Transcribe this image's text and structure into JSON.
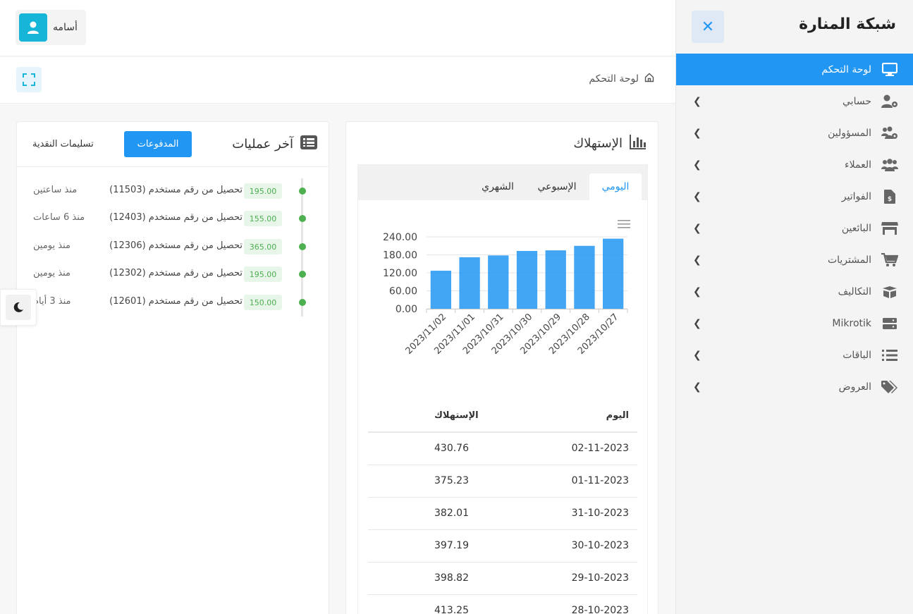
{
  "sidebar": {
    "brand": "شبكة المنارة",
    "items": [
      {
        "label": "لوحة التحكم",
        "icon": "monitor-icon",
        "active": true
      },
      {
        "label": "حسابي",
        "icon": "user-cog-icon"
      },
      {
        "label": "المسؤولين",
        "icon": "users-cog-icon"
      },
      {
        "label": "العملاء",
        "icon": "users-icon"
      },
      {
        "label": "الفواتير",
        "icon": "invoice-dollar-icon"
      },
      {
        "label": "البائعين",
        "icon": "store-icon"
      },
      {
        "label": "المشتريات",
        "icon": "cart-icon"
      },
      {
        "label": "التكاليف",
        "icon": "box-open-icon"
      },
      {
        "label": "Mikrotik",
        "icon": "server-icon"
      },
      {
        "label": "الباقات",
        "icon": "list-icon"
      },
      {
        "label": "العروض",
        "icon": "tags-icon"
      }
    ]
  },
  "topbar": {
    "user_name": "أسامه"
  },
  "breadcrumb": {
    "current": "لوحة التحكم"
  },
  "operations": {
    "title": "آخر عمليات",
    "tab_payments": "المدفوعات",
    "tab_cash": "تسليمات النقدية",
    "items": [
      {
        "amount": "195.00",
        "text": "تحصيل من رقم مستخدم (11503)",
        "time": "منذ ساعتين"
      },
      {
        "amount": "155.00",
        "text": "تحصيل من رقم مستخدم (12403)",
        "time": "منذ 6 ساعات"
      },
      {
        "amount": "365.00",
        "text": "تحصيل من رقم مستخدم (12306)",
        "time": "منذ يومين"
      },
      {
        "amount": "195.00",
        "text": "تحصيل من رقم مستخدم (12302)",
        "time": "منذ يومين"
      },
      {
        "amount": "150.00",
        "text": "تحصيل من رقم مستخدم (12601)",
        "time": "منذ 3 أيام"
      }
    ]
  },
  "usage": {
    "title": "الإستهلاك",
    "tabs": {
      "daily": "اليومي",
      "weekly": "الإسبوعي",
      "monthly": "الشهري"
    },
    "table": {
      "col_day": "اليوم",
      "col_usage": "الإستهلاك",
      "rows": [
        {
          "day": "02-11-2023",
          "usage": "430.76"
        },
        {
          "day": "01-11-2023",
          "usage": "375.23"
        },
        {
          "day": "31-10-2023",
          "usage": "382.01"
        },
        {
          "day": "30-10-2023",
          "usage": "397.19"
        },
        {
          "day": "29-10-2023",
          "usage": "398.82"
        },
        {
          "day": "28-10-2023",
          "usage": "413.25"
        }
      ]
    }
  },
  "colors": {
    "accent": "#2196f3",
    "success": "#4caf50",
    "teal": "#17b6d8"
  },
  "chart_data": {
    "type": "bar",
    "categories": [
      "2023/11/02",
      "2023/11/01",
      "2023/10/31",
      "2023/10/30",
      "2023/10/29",
      "2023/10/28",
      "2023/10/27"
    ],
    "values": [
      127,
      172,
      178,
      193,
      195,
      210,
      234
    ],
    "y_ticks": [
      "240.00",
      "180.00",
      "120.00",
      "60.00",
      "0.00"
    ],
    "ylim": [
      0,
      240
    ],
    "grid": true,
    "bar_color": "#2196f3"
  }
}
